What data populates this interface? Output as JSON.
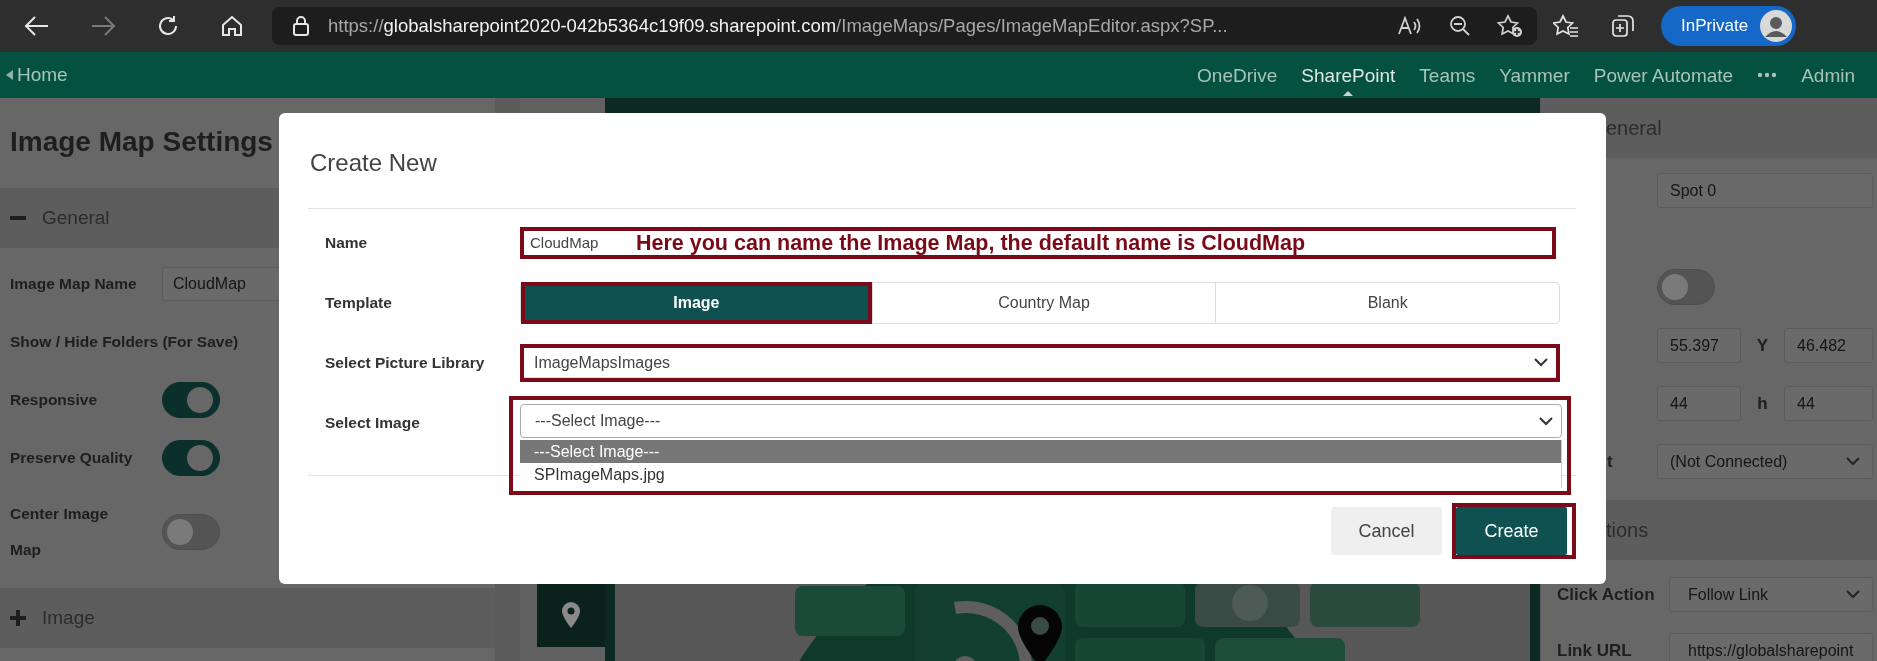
{
  "browser": {
    "address": {
      "scheme": "https://",
      "host": "globalsharepoint2020-042b5364c19f09.sharepoint.com",
      "path": "/ImageMaps/Pages/ImageMapEditor.aspx?SP..."
    },
    "profile_label": "InPrivate"
  },
  "suite_bar": {
    "home": "Home",
    "links": [
      {
        "kind": "link",
        "label": "OneDrive",
        "selected": false
      },
      {
        "kind": "link",
        "label": "SharePoint",
        "selected": true
      },
      {
        "kind": "link",
        "label": "Teams",
        "selected": false
      },
      {
        "kind": "link",
        "label": "Yammer",
        "selected": false
      },
      {
        "kind": "link",
        "label": "Power Automate",
        "selected": false
      },
      {
        "kind": "more"
      },
      {
        "kind": "link",
        "label": "Admin",
        "selected": false
      }
    ]
  },
  "settings_panel": {
    "title": "Image Map Settings",
    "sections": [
      {
        "label": "General",
        "expanded": true,
        "rows": [
          {
            "kind": "text",
            "label": "Image Map Name",
            "value": "CloudMap"
          },
          {
            "kind": "label",
            "label": "Show / Hide Folders (For Save)"
          },
          {
            "kind": "toggle",
            "label": "Responsive",
            "on": true
          },
          {
            "kind": "toggle",
            "label": "Preserve Quality",
            "on": true
          },
          {
            "kind": "toggle",
            "label": "Center Image Map",
            "on": false
          }
        ]
      },
      {
        "label": "Image",
        "expanded": false
      }
    ]
  },
  "spot_panel": {
    "sections": [
      {
        "label": "eneral",
        "rows": [
          {
            "kind": "text",
            "value": "Spot 0"
          },
          {
            "kind": "toggle",
            "on": false
          },
          {
            "kind": "pair",
            "value": "55.397",
            "label_2": "Y",
            "value_2": "46.482"
          },
          {
            "kind": "pair",
            "value": "44",
            "label_2": "h",
            "value_2": "44"
          },
          {
            "kind": "select",
            "label": "t",
            "value": "(Not Connected)"
          }
        ]
      },
      {
        "label": "tions",
        "rows": [
          {
            "kind": "select",
            "label": "Click Action",
            "value": "Follow Link"
          },
          {
            "kind": "text",
            "label": "Link URL",
            "value": "https://globalsharepoint"
          }
        ]
      }
    ]
  },
  "dialog": {
    "title": "Create New",
    "name": {
      "label": "Name",
      "value": "CloudMap",
      "highlighted": true,
      "note": "Here you can name the Image Map, the default name is CloudMap"
    },
    "template": {
      "label": "Template",
      "options": [
        {
          "label": "Image",
          "selected": true,
          "highlighted": true
        },
        {
          "label": "Country Map",
          "selected": false,
          "highlighted": false
        },
        {
          "label": "Blank",
          "selected": false,
          "highlighted": false
        }
      ]
    },
    "library": {
      "label": "Select Picture Library",
      "value": "ImageMapsImages",
      "highlighted": true
    },
    "image": {
      "label": "Select Image",
      "value": "---Select Image---",
      "open": true,
      "highlighted": true,
      "options": [
        {
          "label": "---Select Image---",
          "selected": true
        },
        {
          "label": "SPImageMaps.jpg",
          "selected": false
        }
      ]
    },
    "buttons": [
      {
        "label": "Cancel",
        "kind": "secondary",
        "highlighted": false
      },
      {
        "label": "Create",
        "kind": "primary",
        "highlighted": true
      }
    ]
  }
}
